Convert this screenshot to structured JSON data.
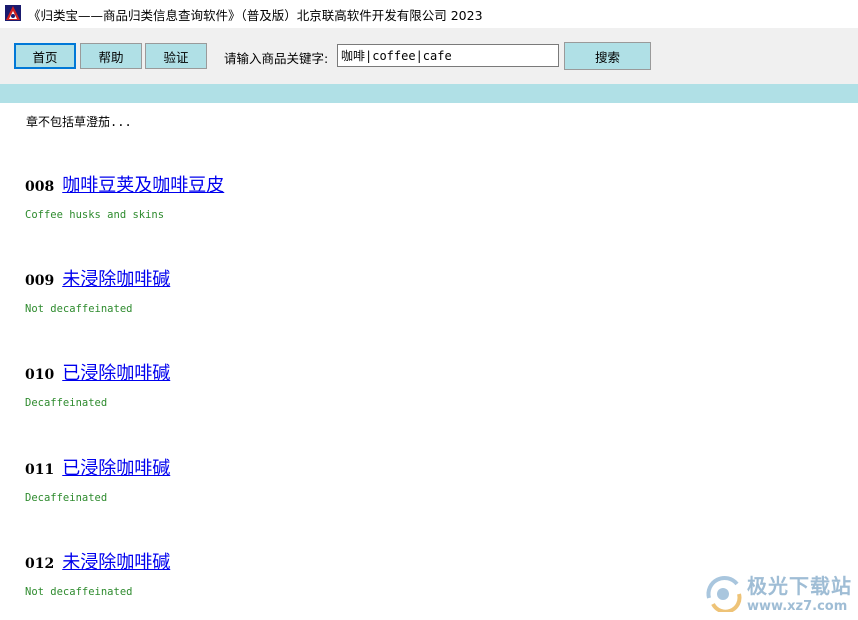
{
  "window": {
    "title": "《归类宝——商品归类信息查询软件》（普及版）北京联高软件开发有限公司 2023"
  },
  "toolbar": {
    "home_label": "首页",
    "help_label": "帮助",
    "verify_label": "验证",
    "search_prompt": "请输入商品关键字:",
    "search_value": "咖啡|coffee|cafe",
    "search_button": "搜索"
  },
  "content": {
    "note": "章不包括草澄茄...",
    "entries": [
      {
        "code": "008",
        "title": "咖啡豆荚及咖啡豆皮",
        "desc": "Coffee husks and skins"
      },
      {
        "code": "009",
        "title": "未浸除咖啡碱",
        "desc": "Not decaffeinated"
      },
      {
        "code": "010",
        "title": "已浸除咖啡碱",
        "desc": "Decaffeinated"
      },
      {
        "code": "011",
        "title": "已浸除咖啡碱",
        "desc": "Decaffeinated"
      },
      {
        "code": "012",
        "title": "未浸除咖啡碱",
        "desc": "Not decaffeinated"
      }
    ]
  },
  "watermark": {
    "name": "极光下载站",
    "url": "www.xz7.com"
  },
  "colors": {
    "accent_band": "#b0e0e6",
    "link": "#0000ee",
    "description": "#2e8b2e",
    "toolbar_bg": "#f0f0f0"
  }
}
